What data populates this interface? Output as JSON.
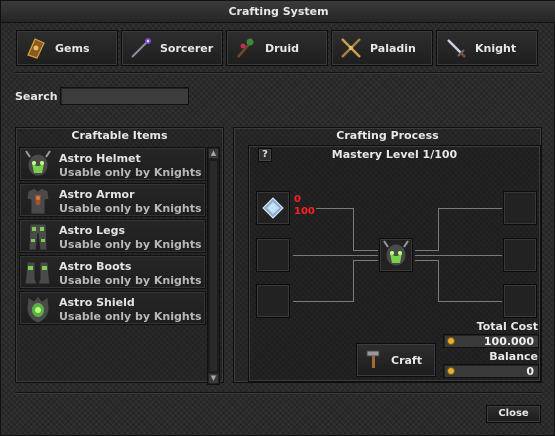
{
  "window": {
    "title": "Crafting System"
  },
  "tabs": [
    {
      "label": "Gems",
      "icon": "gem-pouch-icon"
    },
    {
      "label": "Sorcerer",
      "icon": "wand-icon"
    },
    {
      "label": "Druid",
      "icon": "rod-icon"
    },
    {
      "label": "Paladin",
      "icon": "crossbow-icon"
    },
    {
      "label": "Knight",
      "icon": "sword-icon"
    }
  ],
  "search": {
    "label": "Search",
    "value": "",
    "placeholder": ""
  },
  "craftable": {
    "title": "Craftable Items",
    "items": [
      {
        "name": "Astro Helmet",
        "sub": "Usable only by Knights",
        "icon": "helmet-icon"
      },
      {
        "name": "Astro Armor",
        "sub": "Usable only by Knights",
        "icon": "armor-icon"
      },
      {
        "name": "Astro Legs",
        "sub": "Usable only by Knights",
        "icon": "legs-icon"
      },
      {
        "name": "Astro Boots",
        "sub": "Usable only by Knights",
        "icon": "boots-icon"
      },
      {
        "name": "Astro Shield",
        "sub": "Usable only by Knights",
        "icon": "shield-icon"
      }
    ]
  },
  "process": {
    "title": "Crafting Process",
    "help_label": "?",
    "mastery": "Mastery Level 1/100",
    "ingredient": {
      "icon": "crystal-icon",
      "have": "0",
      "need": "100"
    },
    "result_icon": "helmet-icon",
    "craft_label": "Craft",
    "total_cost_label": "Total Cost",
    "total_cost": "100.000",
    "balance_label": "Balance",
    "balance": "0"
  },
  "footer": {
    "close_label": "Close"
  },
  "colors": {
    "accent_red": "#ff2020",
    "coin": "#e8b030"
  }
}
